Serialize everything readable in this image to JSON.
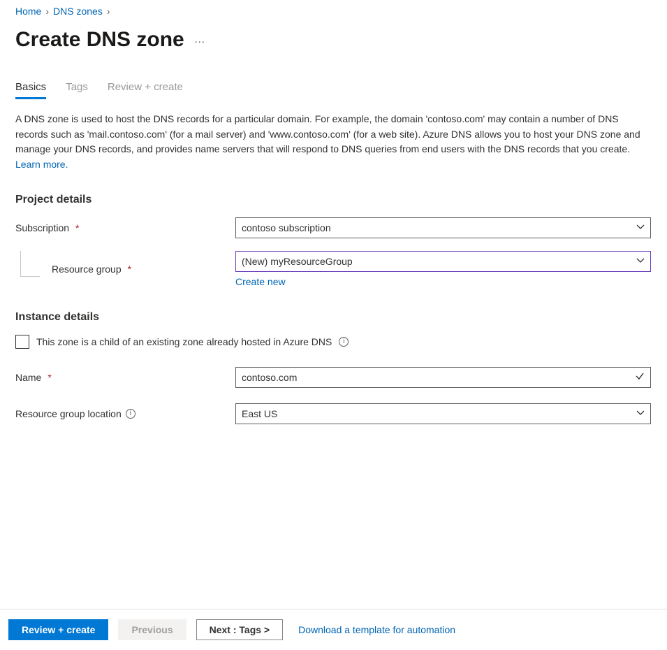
{
  "breadcrumb": {
    "home": "Home",
    "dns_zones": "DNS zones"
  },
  "title": "Create DNS zone",
  "tabs": {
    "basics": "Basics",
    "tags": "Tags",
    "review": "Review + create"
  },
  "description": {
    "text": "A DNS zone is used to host the DNS records for a particular domain. For example, the domain 'contoso.com' may contain a number of DNS records such as 'mail.contoso.com' (for a mail server) and 'www.contoso.com' (for a web site). Azure DNS allows you to host your DNS zone and manage your DNS records, and provides name servers that will respond to DNS queries from end users with the DNS records that you create.  ",
    "learn_more": "Learn more."
  },
  "project": {
    "heading": "Project details",
    "subscription_label": "Subscription",
    "subscription_value": "contoso subscription",
    "rg_label": "Resource group",
    "rg_value": "(New) myResourceGroup",
    "create_new": "Create new"
  },
  "instance": {
    "heading": "Instance details",
    "child_label": "This zone is a child of an existing zone already hosted in Azure DNS",
    "name_label": "Name",
    "name_value": "contoso.com",
    "rgloc_label": "Resource group location",
    "rgloc_value": "East US"
  },
  "footer": {
    "review": "Review + create",
    "previous": "Previous",
    "next": "Next : Tags >",
    "download": "Download a template for automation"
  },
  "info_glyph": "i"
}
